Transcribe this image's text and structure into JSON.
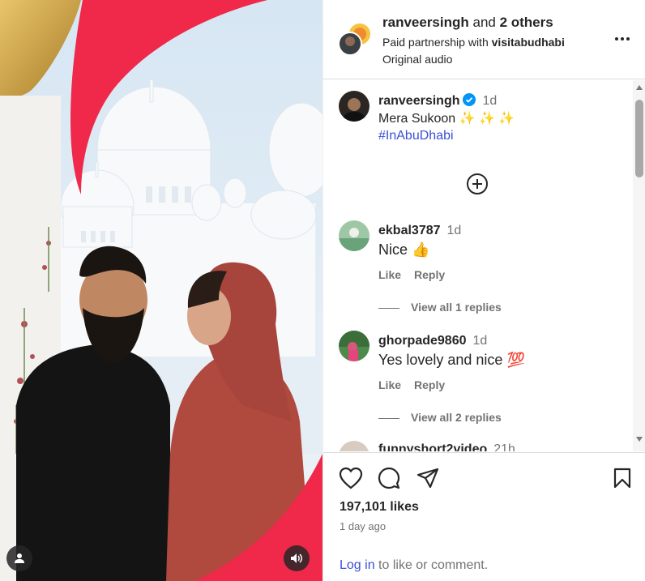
{
  "header": {
    "username": "ranveersingh",
    "conjunction": " and ",
    "others": "2 others",
    "partnership_prefix": "Paid partnership with ",
    "partner": "visitabudhabi",
    "audio": "Original audio"
  },
  "caption": {
    "username": "ranveersingh",
    "time": "1d",
    "text": "Mera Sukoon ✨ ✨ ✨",
    "hashtag": "#InAbuDhabi"
  },
  "comments": [
    {
      "username": "ekbal3787",
      "time": "1d",
      "text": "Nice 👍",
      "like": "Like",
      "reply": "Reply",
      "view_replies": "View all 1 replies"
    },
    {
      "username": "ghorpade9860",
      "time": "1d",
      "text": "Yes lovely and nice 💯",
      "like": "Like",
      "reply": "Reply",
      "view_replies": "View all 2 replies"
    },
    {
      "username": "funnyshort2video",
      "time": "21h"
    }
  ],
  "footer": {
    "likes": "197,101 likes",
    "time_ago": "1 day ago",
    "login_link": "Log in",
    "login_suffix": " to like or comment."
  },
  "colors": {
    "accent_red": "#f0284a",
    "link_blue": "#3b50d6",
    "verified_blue": "#0095f6",
    "muted_text": "#737373"
  },
  "icons": [
    "more-icon",
    "add-comment-icon",
    "heart-icon",
    "comment-icon",
    "share-icon",
    "bookmark-icon",
    "user-tag-icon",
    "sound-icon",
    "verified-badge-icon"
  ]
}
